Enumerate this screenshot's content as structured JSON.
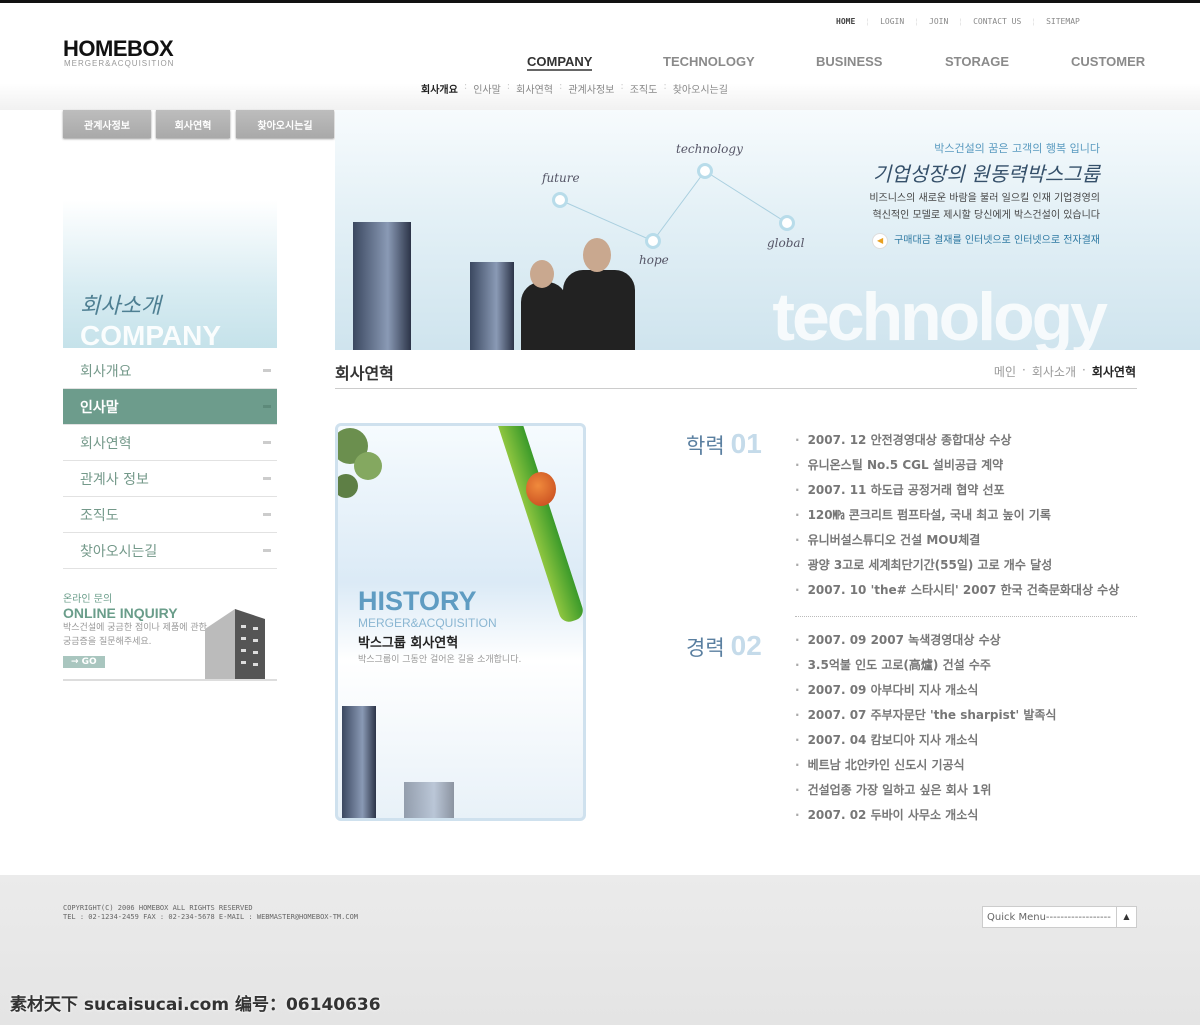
{
  "header": {
    "logo": "HOMEBOX",
    "logo_sub": "MERGER&ACQUISITION",
    "top_links": [
      "HOME",
      "LOGIN",
      "JOIN",
      "CONTACT US",
      "SITEMAP"
    ],
    "main_nav": [
      "COMPANY",
      "TECHNOLOGY",
      "BUSINESS",
      "STORAGE",
      "CUSTOMER"
    ],
    "sub_nav": [
      "회사개요",
      "인사말",
      "회사연혁",
      "관계사정보",
      "조직도",
      "찾아오시는길"
    ]
  },
  "tab_buttons": [
    "관계사정보",
    "회사연혁",
    "찾아오시는길"
  ],
  "banner": {
    "nodes": [
      "technology",
      "future",
      "hope",
      "global"
    ],
    "big_text": "technology",
    "line1": "박스건설의 꿈은 고객의 행복 입니다",
    "line2": "기업성장의 원동력박스그룹",
    "line3": "비즈니스의 새로운 바람을 불러 일으킬 인재 기업경영의",
    "line4": "혁신적인 모델로 제시할 당신에게 박스건설이 있습니다",
    "line5": "구매대금 결재를 인터넷으로 인터넷으로 전자결재"
  },
  "sidebar": {
    "visual_kr": "회사소개",
    "visual_en": "COMPANY",
    "items": [
      {
        "label": "회사개요"
      },
      {
        "label": "인사말",
        "active": true
      },
      {
        "label": "회사연혁"
      },
      {
        "label": "관계사 정보"
      },
      {
        "label": "조직도"
      },
      {
        "label": "찾아오시는길"
      }
    ],
    "inquiry": {
      "kr": "온라인 문의",
      "en": "ONLINE INQUIRY",
      "desc": "박스건설에 궁금한 점이나 제품에 관한 궁금증을 질문해주세요.",
      "go": "→ GO"
    }
  },
  "content": {
    "title": "회사연혁",
    "breadcrumb": [
      "메인",
      "회사소개",
      "회사연혁"
    ],
    "card": {
      "title": "HISTORY",
      "sub": "MERGER&ACQUISITION",
      "kr_title": "박스그룹 회사연혁",
      "desc": "박스그룹이 그동안 걸어온 길을 소개합니다."
    },
    "sections": [
      {
        "label": "학력",
        "num": "01",
        "items": [
          "2007. 12  안전경영대상 종합대상 수상",
          "유니온스틸 No.5 CGL 설비공급 계약",
          "2007. 11  하도급 공정거래 협약 선포",
          "120㎫ 콘크리트 펌프타설, 국내 최고 높이 기록",
          "유니버설스튜디오 건설 MOU체결",
          "광양 3고로 세계최단기간(55일) 고로 개수 달성",
          "2007. 10  'the# 스타시티' 2007 한국 건축문화대상 수상"
        ]
      },
      {
        "label": "경력",
        "num": "02",
        "items": [
          "2007. 09 2007 녹색경영대상 수상",
          "3.5억불 인도 고로(高爐) 건설 수주",
          "2007. 09 아부다비 지사 개소식",
          "2007. 07 주부자문단 'the sharpist' 발족식",
          "2007. 04 캄보디아 지사 개소식",
          "베트남 北안카인 신도시 기공식",
          "건설업종 가장 일하고 싶은 회사 1위",
          "2007. 02 두바이 사무소 개소식"
        ]
      }
    ]
  },
  "footer": {
    "copyright": "COPYRIGHT(C) 2006 HOMEBOX ALL RIGHTS RESERVED",
    "contact": "TEL : 02-1234-2459 FAX : 02-234-5678  E-MAIL : WEBMASTER@HOMEBOX-TM.COM",
    "quick_menu": "Quick Menu------------------"
  },
  "watermark": "素材天下 sucaisucai.com  编号：06140636",
  "colors": {
    "accent_green": "#6d9c8c",
    "accent_blue": "#5f9cc2"
  }
}
